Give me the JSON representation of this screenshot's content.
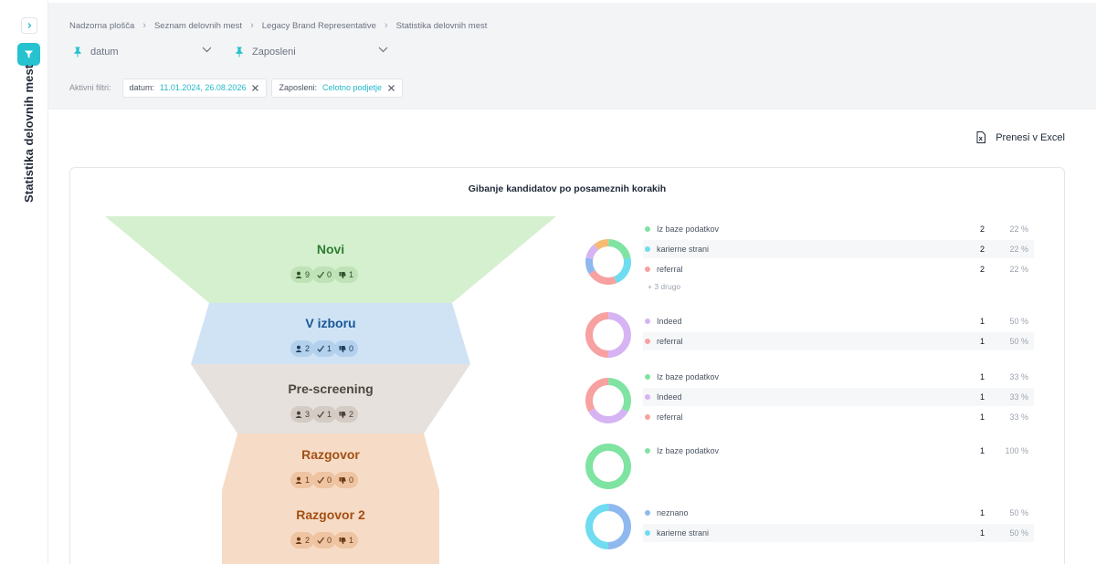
{
  "sidebar": {
    "title": "Statistika delovnih mest"
  },
  "breadcrumb": [
    "Nadzorna plošča",
    "Seznam delovnih mest",
    "Legacy Brand Representative",
    "Statistika delovnih mest"
  ],
  "selects": {
    "date": "datum",
    "employee": "Zaposleni"
  },
  "filters": {
    "label": "Aktivni filtri:",
    "chips": [
      {
        "key": "datum:",
        "value": "11.01.2024, 26.08.2026"
      },
      {
        "key": "Zaposleni:",
        "value": "Celotno podjetje"
      }
    ]
  },
  "toolbar": {
    "excel_label": "Prenesi v Excel"
  },
  "card": {
    "title": "Gibanje kandidatov po posameznih korakih"
  },
  "funnel": [
    {
      "name": "Novi",
      "total": "9",
      "accepted": "0",
      "rejected": "1",
      "fill": "#d5f0cf",
      "text": "#2e7d32",
      "badge": "#bfe3b7",
      "badgeText": "#33512f"
    },
    {
      "name": "V izboru",
      "total": "2",
      "accepted": "1",
      "rejected": "0",
      "fill": "#cfe3f5",
      "text": "#1a5796",
      "badge": "#b3d1ec",
      "badgeText": "#1e3e63"
    },
    {
      "name": "Pre-screening",
      "total": "3",
      "accepted": "1",
      "rejected": "2",
      "fill": "#e6e1dc",
      "text": "#4d4740",
      "badge": "#d4ccc4",
      "badgeText": "#4a423a"
    },
    {
      "name": "Razgovor",
      "total": "1",
      "accepted": "0",
      "rejected": "0",
      "fill": "#f6dcc6",
      "text": "#a34f14",
      "badge": "#eec4a2",
      "badgeText": "#6b3a14"
    },
    {
      "name": "Razgovor 2",
      "total": "2",
      "accepted": "0",
      "rejected": "1",
      "fill": "#f6dcc6",
      "text": "#a34f14",
      "badge": "#eec4a2",
      "badgeText": "#6b3a14"
    }
  ],
  "sources": [
    {
      "segments": [
        {
          "value": 22,
          "color": "#7fe3a1"
        },
        {
          "value": 22,
          "color": "#6fdcef"
        },
        {
          "value": 22,
          "color": "#f7a1a1"
        },
        {
          "value": 12,
          "color": "#8fb8ef"
        },
        {
          "value": 11,
          "color": "#d6b4f3"
        },
        {
          "value": 11,
          "color": "#f7bb74"
        }
      ],
      "rows": [
        {
          "name": "Iz baze podatkov",
          "count": "2",
          "pct": "22 %",
          "color": "#7fe3a1"
        },
        {
          "name": "karierne strani",
          "count": "2",
          "pct": "22 %",
          "color": "#6fdcef"
        },
        {
          "name": "referral",
          "count": "2",
          "pct": "22 %",
          "color": "#f7a1a1"
        }
      ],
      "more": "+ 3 drugo"
    },
    {
      "segments": [
        {
          "value": 50,
          "color": "#d6b4f3"
        },
        {
          "value": 50,
          "color": "#f7a1a1"
        }
      ],
      "rows": [
        {
          "name": "Indeed",
          "count": "1",
          "pct": "50 %",
          "color": "#d6b4f3"
        },
        {
          "name": "referral",
          "count": "1",
          "pct": "50 %",
          "color": "#f7a1a1"
        }
      ]
    },
    {
      "segments": [
        {
          "value": 33,
          "color": "#7fe3a1"
        },
        {
          "value": 33,
          "color": "#d6b4f3"
        },
        {
          "value": 33,
          "color": "#f7a1a1"
        }
      ],
      "rows": [
        {
          "name": "Iz baze podatkov",
          "count": "1",
          "pct": "33 %",
          "color": "#7fe3a1"
        },
        {
          "name": "Indeed",
          "count": "1",
          "pct": "33 %",
          "color": "#d6b4f3"
        },
        {
          "name": "referral",
          "count": "1",
          "pct": "33 %",
          "color": "#f7a1a1"
        }
      ]
    },
    {
      "segments": [
        {
          "value": 100,
          "color": "#7fe3a1"
        }
      ],
      "rows": [
        {
          "name": "Iz baze podatkov",
          "count": "1",
          "pct": "100 %",
          "color": "#7fe3a1"
        }
      ]
    },
    {
      "segments": [
        {
          "value": 50,
          "color": "#8fb8ef"
        },
        {
          "value": 50,
          "color": "#6fdcef"
        }
      ],
      "rows": [
        {
          "name": "neznano",
          "count": "1",
          "pct": "50 %",
          "color": "#8fb8ef"
        },
        {
          "name": "karierne strani",
          "count": "1",
          "pct": "50 %",
          "color": "#6fdcef"
        }
      ]
    }
  ]
}
